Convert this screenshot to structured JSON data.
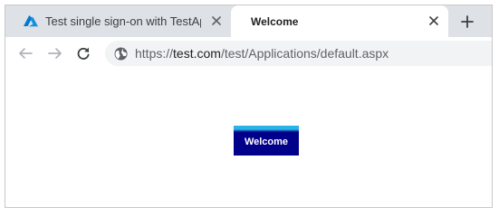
{
  "browser": {
    "tabs": [
      {
        "title": "Test single sign-on with TestApp",
        "favicon": "azure-icon",
        "active": false
      },
      {
        "title": "Welcome",
        "active": true
      }
    ],
    "new_tab_icon": "plus-icon",
    "nav": {
      "back_icon": "back-arrow-icon",
      "forward_icon": "forward-arrow-icon",
      "reload_icon": "reload-icon"
    },
    "address": {
      "site_icon": "globe-icon",
      "scheme": "https://",
      "host": "test.com",
      "path": "/test/Applications/default.aspx"
    }
  },
  "page": {
    "welcome_button_label": "Welcome"
  },
  "colors": {
    "tabstrip": "#dee1e6",
    "omnibox": "#f1f3f4",
    "button_background": "#00008b",
    "button_accent": "#2ab3e6",
    "azure_blue": "#0078d4"
  }
}
